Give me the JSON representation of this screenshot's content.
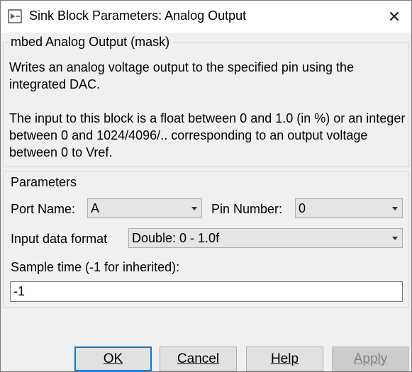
{
  "window": {
    "title": "Sink Block Parameters: Analog Output",
    "close_glyph": "✕"
  },
  "mask": {
    "legend": "mbed Analog Output (mask)",
    "description_1": "Writes an analog voltage output to the specified pin using the integrated DAC.",
    "description_2": "The input to this block is a float between 0 and 1.0 (in %) or an integer between 0 and 1024/4096/.. corresponding to an output voltage between 0 to Vref."
  },
  "parameters": {
    "legend": "Parameters",
    "port_name_label": "Port Name:",
    "port_name_value": "A",
    "pin_number_label": "Pin Number:",
    "pin_number_value": "0",
    "input_format_label": "Input data format",
    "input_format_value": "Double: 0 - 1.0f",
    "sample_time_label": "Sample time (-1 for inherited):",
    "sample_time_value": "-1"
  },
  "buttons": {
    "ok": "OK",
    "cancel": "Cancel",
    "help": "Help",
    "apply": "Apply"
  },
  "colors": {
    "default_button_border": "#0078d7",
    "dialog_background": "#f0f0f0"
  },
  "icons": {
    "app": "simulink-block-icon",
    "close": "close-icon",
    "dropdown": "chevron-down-icon"
  }
}
